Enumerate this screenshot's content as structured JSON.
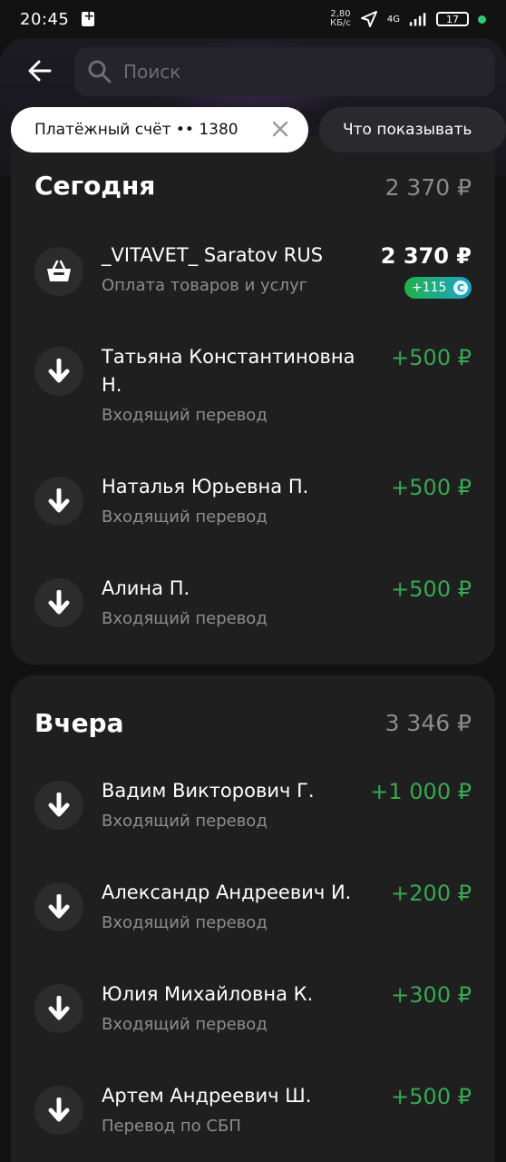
{
  "status_bar": {
    "time": "20:45",
    "speed": "2,80",
    "speed_unit": "КБ/с",
    "network": "4G",
    "battery": "17"
  },
  "search": {
    "placeholder": "Поиск"
  },
  "filters": {
    "account_chip": "Платёжный счёт •• 1380",
    "what_to_show": "Что показывать"
  },
  "sections": [
    {
      "title": "Сегодня",
      "total": "2 370 ₽",
      "transactions": [
        {
          "name": "_VITAVET_ Saratov RUS",
          "subtitle": "Оплата товаров и услуг",
          "amount": "2 370 ₽",
          "cashback": "+115",
          "icon": "shopping-basket-icon"
        },
        {
          "name": "Татьяна Константиновна Н.",
          "subtitle": "Входящий перевод",
          "amount": "+500 ₽",
          "icon": "arrow-down-icon"
        },
        {
          "name": "Наталья Юрьевна П.",
          "subtitle": "Входящий перевод",
          "amount": "+500 ₽",
          "icon": "arrow-down-icon"
        },
        {
          "name": "Алина П.",
          "subtitle": "Входящий перевод",
          "amount": "+500 ₽",
          "icon": "arrow-down-icon"
        }
      ]
    },
    {
      "title": "Вчера",
      "total": "3 346 ₽",
      "transactions": [
        {
          "name": "Вадим Викторович Г.",
          "subtitle": "Входящий перевод",
          "amount": "+1 000 ₽",
          "icon": "arrow-down-icon"
        },
        {
          "name": "Александр Андреевич И.",
          "subtitle": "Входящий перевод",
          "amount": "+200 ₽",
          "icon": "arrow-down-icon"
        },
        {
          "name": "Юлия Михайловна К.",
          "subtitle": "Входящий перевод",
          "amount": "+300 ₽",
          "icon": "arrow-down-icon"
        },
        {
          "name": "Артем Андреевич Ш.",
          "subtitle": "Перевод по СБП",
          "amount": "+500 ₽",
          "icon": "arrow-down-icon"
        }
      ]
    }
  ],
  "colors": {
    "background": "#121212",
    "card": "#1f1f1f",
    "positive": "#35a853",
    "muted": "#8d8d8d"
  }
}
